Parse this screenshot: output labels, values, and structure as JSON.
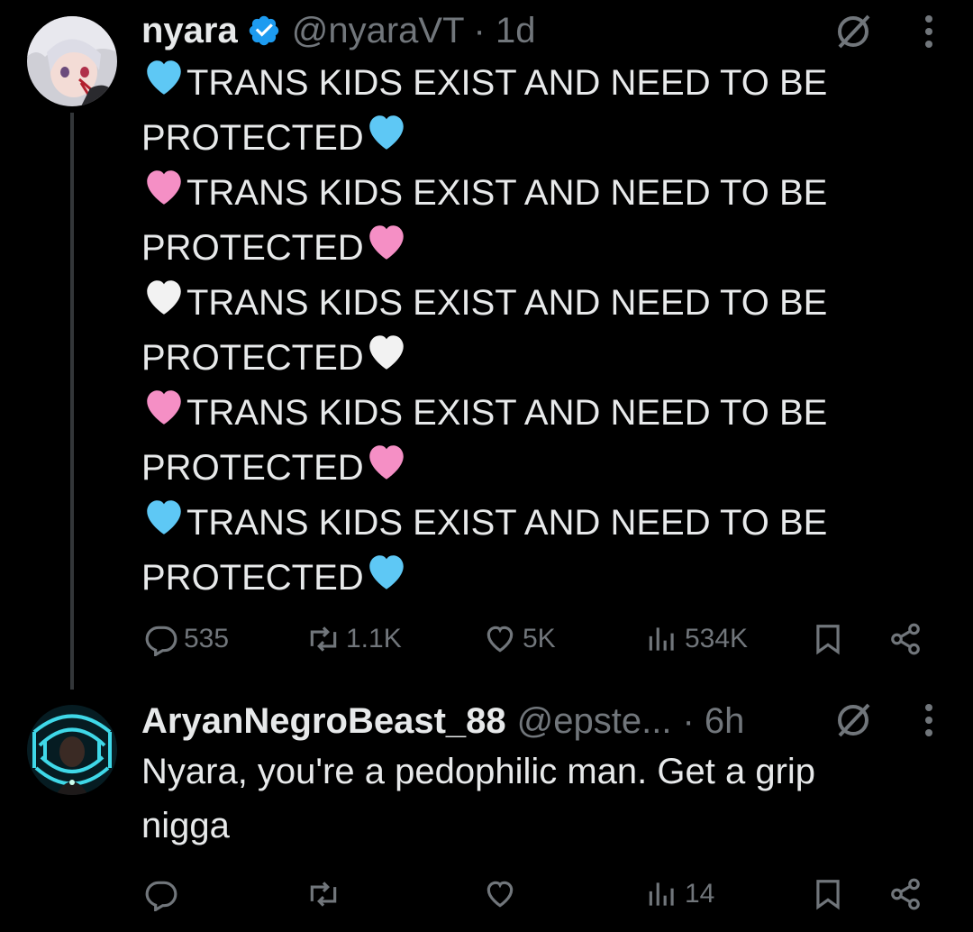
{
  "tweet1": {
    "display_name": "nyara",
    "handle": "@nyaraVT",
    "time": "· 1d",
    "lines": [
      {
        "text": "TRANS KIDS EXIST AND NEED TO BE",
        "lead_heart": "blue"
      },
      {
        "text": "PROTECTED",
        "trail_heart": "blue"
      },
      {
        "text": "TRANS KIDS EXIST AND NEED TO BE",
        "lead_heart": "pink"
      },
      {
        "text": "PROTECTED",
        "trail_heart": "pink"
      },
      {
        "text": "TRANS KIDS EXIST AND NEED TO BE",
        "lead_heart": "white"
      },
      {
        "text": "PROTECTED",
        "trail_heart": "white"
      },
      {
        "text": "TRANS KIDS EXIST AND NEED TO BE",
        "lead_heart": "pink"
      },
      {
        "text": "PROTECTED",
        "trail_heart": "pink"
      },
      {
        "text": "TRANS KIDS EXIST AND NEED TO BE",
        "lead_heart": "blue"
      },
      {
        "text": "PROTECTED",
        "trail_heart": "blue"
      }
    ],
    "stats": {
      "replies": "535",
      "reposts": "1.1K",
      "likes": "5K",
      "views": "534K"
    }
  },
  "tweet2": {
    "display_name": "AryanNegroBeast_88",
    "handle": "@epste...",
    "time": "· 6h",
    "text_line1": "Nyara, you're a pedophilic man. Get a grip",
    "text_line2": "nigga",
    "stats": {
      "replies": "",
      "reposts": "",
      "likes": "",
      "views": "14"
    }
  },
  "colors": {
    "background": "#000000",
    "text": "#e7e9ea",
    "secondary": "#71767b",
    "verified": "#1d9bf0",
    "heart_blue": "#5ec8f5",
    "heart_pink": "#f58fc5",
    "heart_white": "#f2f2f2"
  },
  "icons": [
    "verified-badge-icon",
    "grok-icon",
    "more-icon",
    "reply-icon",
    "repost-icon",
    "like-icon",
    "views-icon",
    "bookmark-icon",
    "share-icon"
  ]
}
